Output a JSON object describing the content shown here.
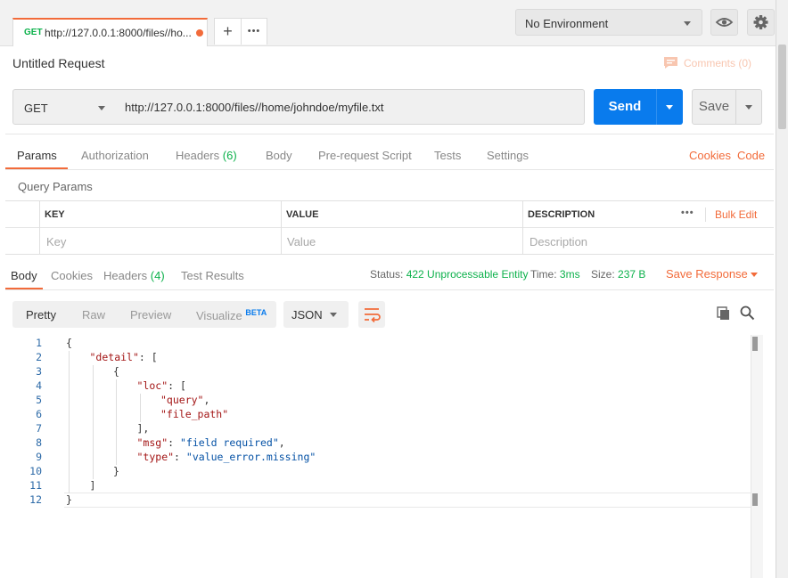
{
  "tabbar": {
    "tab_method": "GET",
    "tab_url": "http://127.0.0.1:8000/files//ho...",
    "add_tab": "+",
    "more_tabs": "•••"
  },
  "environment": {
    "selected": "No Environment"
  },
  "request": {
    "title": "Untitled Request",
    "comments": "Comments (0)",
    "method": "GET",
    "url": "http://127.0.0.1:8000/files//home/johndoe/myfile.txt",
    "send_label": "Send",
    "save_label": "Save"
  },
  "request_tabs": {
    "params": "Params",
    "authorization": "Authorization",
    "headers": "Headers",
    "headers_count": "(6)",
    "body": "Body",
    "pre_request": "Pre-request Script",
    "tests": "Tests",
    "settings": "Settings",
    "cookies": "Cookies",
    "code": "Code"
  },
  "params": {
    "section_title": "Query Params",
    "columns": [
      "KEY",
      "VALUE",
      "DESCRIPTION"
    ],
    "placeholders": [
      "Key",
      "Value",
      "Description"
    ],
    "more": "•••",
    "bulk_edit": "Bulk Edit"
  },
  "response_tabs": {
    "body": "Body",
    "cookies": "Cookies",
    "headers": "Headers",
    "headers_count": "(4)",
    "test_results": "Test Results"
  },
  "response_status": {
    "status_label": "Status:",
    "status_value": "422 Unprocessable Entity",
    "time_label": "Time:",
    "time_value": "3ms",
    "size_label": "Size:",
    "size_value": "237 B",
    "save_response": "Save Response"
  },
  "format": {
    "pretty": "Pretty",
    "raw": "Raw",
    "preview": "Preview",
    "visualize": "Visualize",
    "beta": "BETA",
    "language": "JSON"
  },
  "code_lines": [
    {
      "n": "1",
      "indent": 0,
      "parts": [
        [
          "p",
          "{"
        ]
      ]
    },
    {
      "n": "2",
      "indent": 1,
      "parts": [
        [
          "k",
          "\"detail\""
        ],
        [
          "p",
          ": ["
        ]
      ]
    },
    {
      "n": "3",
      "indent": 2,
      "parts": [
        [
          "p",
          "{"
        ]
      ]
    },
    {
      "n": "4",
      "indent": 3,
      "parts": [
        [
          "k",
          "\"loc\""
        ],
        [
          "p",
          ": ["
        ]
      ]
    },
    {
      "n": "5",
      "indent": 4,
      "parts": [
        [
          "k",
          "\"query\""
        ],
        [
          "p",
          ","
        ]
      ]
    },
    {
      "n": "6",
      "indent": 4,
      "parts": [
        [
          "k",
          "\"file_path\""
        ]
      ]
    },
    {
      "n": "7",
      "indent": 3,
      "parts": [
        [
          "p",
          "],"
        ]
      ]
    },
    {
      "n": "8",
      "indent": 3,
      "parts": [
        [
          "k",
          "\"msg\""
        ],
        [
          "p",
          ": "
        ],
        [
          "s",
          "\"field required\""
        ],
        [
          "p",
          ","
        ]
      ]
    },
    {
      "n": "9",
      "indent": 3,
      "parts": [
        [
          "k",
          "\"type\""
        ],
        [
          "p",
          ": "
        ],
        [
          "s",
          "\"value_error.missing\""
        ]
      ]
    },
    {
      "n": "10",
      "indent": 2,
      "parts": [
        [
          "p",
          "}"
        ]
      ]
    },
    {
      "n": "11",
      "indent": 1,
      "parts": [
        [
          "p",
          "]"
        ]
      ]
    },
    {
      "n": "12",
      "indent": 0,
      "parts": [
        [
          "p",
          "}"
        ]
      ]
    }
  ],
  "colors": {
    "accent": "#f26b3a",
    "send_blue": "#097bed",
    "status_green": "#0cb14b",
    "json_key": "#a31515",
    "json_string": "#0451a5"
  }
}
